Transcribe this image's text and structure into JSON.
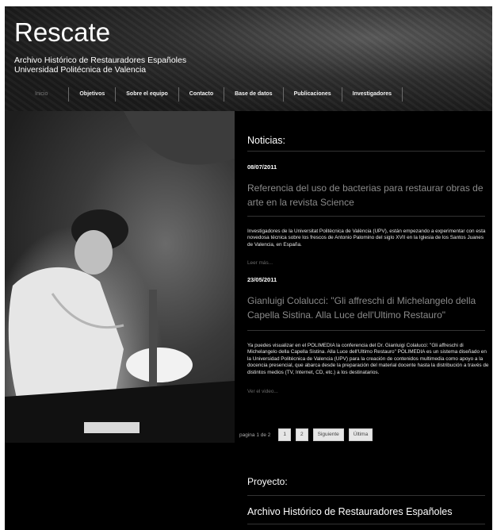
{
  "header": {
    "title": "Rescate",
    "subtitle_line1": "Archivo Histórico de Restauradores Españoles",
    "subtitle_line2": "Universidad Politécnica de Valencia"
  },
  "nav": {
    "items": [
      {
        "label": "Inicio"
      },
      {
        "label": "Objetivos"
      },
      {
        "label": "Sobre el equipo"
      },
      {
        "label": "Contacto"
      },
      {
        "label": "Base de datos"
      },
      {
        "label": "Publicaciones"
      },
      {
        "label": "Investigadores"
      }
    ]
  },
  "news": {
    "heading": "Noticias:",
    "items": [
      {
        "date": "08/07/2011",
        "title": "Referencia del uso de bacterias para restaurar obras de arte en la revista Science",
        "body": "Investigadores de la Universitat Politècnica de València (UPV), están empezando a experimentar con esta novedosa técnica sobre los frescos de Antonio Palomino del siglo XVII en la Iglesia de los Santos Juanes de Valencia, en España.",
        "link": "Leer más..."
      },
      {
        "date": "23/05/2011",
        "title": "Gianluigi Colalucci: \"Gli affreschi di Michelangelo della Capella Sistina. Alla Luce dell'Ultimo Restauro\"",
        "body": "Ya puedes visualizar en el POLIMEDIA la conferencia del Dr. Gianluigi Colalucci: \"Gli affreschi di Michelangelo della Capella Sistina. Alla Luce dell'Ultimo Restauro\" POLIMEDIA es un sistema diseñado en la Universidad Politécnica de Valencia (UPV) para la creación de contenidos multimedia como apoyo a la docencia presencial, que abarca desde la preparación del material docente hasta la distribución a través de distintos medios (TV, Internet, CD, etc.) a los destinatarios.",
        "link": "Ver el video..."
      }
    ]
  },
  "pagination": {
    "info": "pagina 1 de 2",
    "buttons": [
      "1",
      "2",
      "Siguiente",
      "Última"
    ]
  },
  "project": {
    "heading": "Proyecto:",
    "name": "Archivo Histórico de Restauradores Españoles"
  }
}
